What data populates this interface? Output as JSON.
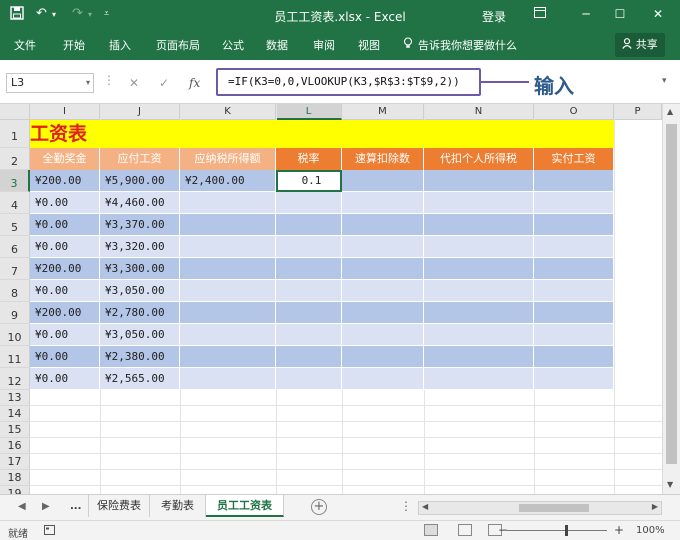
{
  "titlebar": {
    "save_icon": "save-icon",
    "undo_icon": "undo-icon",
    "redo_icon": "redo-icon",
    "title": "员工工资表.xlsx  -  Excel",
    "login": "登录",
    "ribbon_display_icon": "ribbon-display-icon",
    "minimize_icon": "minimize-icon",
    "maximize_icon": "maximize-icon",
    "close_icon": "close-icon"
  },
  "ribbon": {
    "tabs": [
      "文件",
      "开始",
      "插入",
      "页面布局",
      "公式",
      "数据",
      "审阅",
      "视图"
    ],
    "tell_me": "告诉我你想要做什么",
    "share": "共享"
  },
  "formula_bar": {
    "name_box": "L3",
    "formula": "=IF(K3=0,0,VLOOKUP(K3,$R$3:$T$9,2))",
    "annotation": "输入"
  },
  "columns": [
    "I",
    "J",
    "K",
    "L",
    "M",
    "N",
    "O",
    "P"
  ],
  "sheet": {
    "title": "工资表",
    "headers": [
      "全勤奖金",
      "应付工资",
      "应纳税所得额",
      "税率",
      "速算扣除数",
      "代扣个人所得税",
      "实付工资"
    ],
    "rows": [
      {
        "num": "3",
        "cells": [
          "¥200.00",
          "¥5,900.00",
          "¥2,400.00",
          "0.1",
          "",
          "",
          ""
        ]
      },
      {
        "num": "4",
        "cells": [
          "¥0.00",
          "¥4,460.00",
          "",
          "",
          "",
          "",
          ""
        ]
      },
      {
        "num": "5",
        "cells": [
          "¥0.00",
          "¥3,370.00",
          "",
          "",
          "",
          "",
          ""
        ]
      },
      {
        "num": "6",
        "cells": [
          "¥0.00",
          "¥3,320.00",
          "",
          "",
          "",
          "",
          ""
        ]
      },
      {
        "num": "7",
        "cells": [
          "¥200.00",
          "¥3,300.00",
          "",
          "",
          "",
          "",
          ""
        ]
      },
      {
        "num": "8",
        "cells": [
          "¥0.00",
          "¥3,050.00",
          "",
          "",
          "",
          "",
          ""
        ]
      },
      {
        "num": "9",
        "cells": [
          "¥200.00",
          "¥2,780.00",
          "",
          "",
          "",
          "",
          ""
        ]
      },
      {
        "num": "10",
        "cells": [
          "¥0.00",
          "¥3,050.00",
          "",
          "",
          "",
          "",
          ""
        ]
      },
      {
        "num": "11",
        "cells": [
          "¥0.00",
          "¥2,380.00",
          "",
          "",
          "",
          "",
          ""
        ]
      },
      {
        "num": "12",
        "cells": [
          "¥0.00",
          "¥2,565.00",
          "",
          "",
          "",
          "",
          ""
        ]
      }
    ],
    "empty_rows": [
      "13",
      "14",
      "15",
      "16",
      "17",
      "18",
      "19"
    ]
  },
  "sheet_tabs": {
    "ellipsis": "...",
    "tabs": [
      "保险费表",
      "考勤表",
      "员工工资表"
    ],
    "active": "员工工资表"
  },
  "status": {
    "ready": "就绪",
    "zoom": "100%"
  },
  "colors": {
    "excel_green": "#217346",
    "title_fill": "#ffff00",
    "title_text": "#e02020",
    "header_fill": "#f4b183",
    "row_dark": "#b4c6e7",
    "row_light": "#d9e1f2",
    "annotation": "#6c5aa8"
  }
}
